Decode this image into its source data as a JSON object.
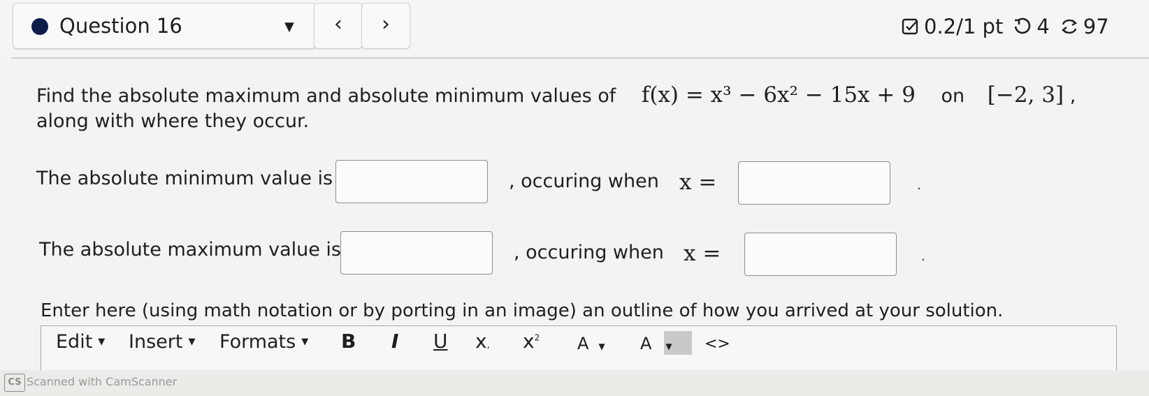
{
  "header": {
    "question_label": "Question 16",
    "prev_icon": "chevron-left-icon",
    "next_icon": "chevron-right-icon",
    "score": "0.2/1 pt",
    "retries": "4",
    "attempts": "97",
    "dot_color": "#0d1b49"
  },
  "problem": {
    "text_before": "Find the absolute maximum and absolute minimum values of",
    "function": "f(x) = x³ − 6x² − 15x + 9",
    "on_word": "on",
    "interval": "[−2, 3]",
    "comma": ",",
    "text_line2": "along with where they occur."
  },
  "min_row": {
    "label": "The absolute minimum value is",
    "value_input": "",
    "occurring_text": ", occuring when",
    "x_eq": "x =",
    "x_input": "",
    "period": "."
  },
  "max_row": {
    "label": "The absolute maximum value is",
    "value_input": "",
    "occurring_text": ", occuring when",
    "x_eq": "x =",
    "x_input": "",
    "period": "."
  },
  "outline_prompt": "Enter here (using math notation or by porting in an image) an outline of how you arrived at your solution.",
  "editor": {
    "menus": [
      "Edit",
      "Insert",
      "Formats"
    ],
    "bold": "B",
    "italic": "I",
    "underline": "U",
    "subscript": "x",
    "superscript": "x",
    "font_color": "A",
    "highlight": "A",
    "code": "<>"
  },
  "watermark": {
    "logo": "CS",
    "text": "Scanned with CamScanner"
  }
}
